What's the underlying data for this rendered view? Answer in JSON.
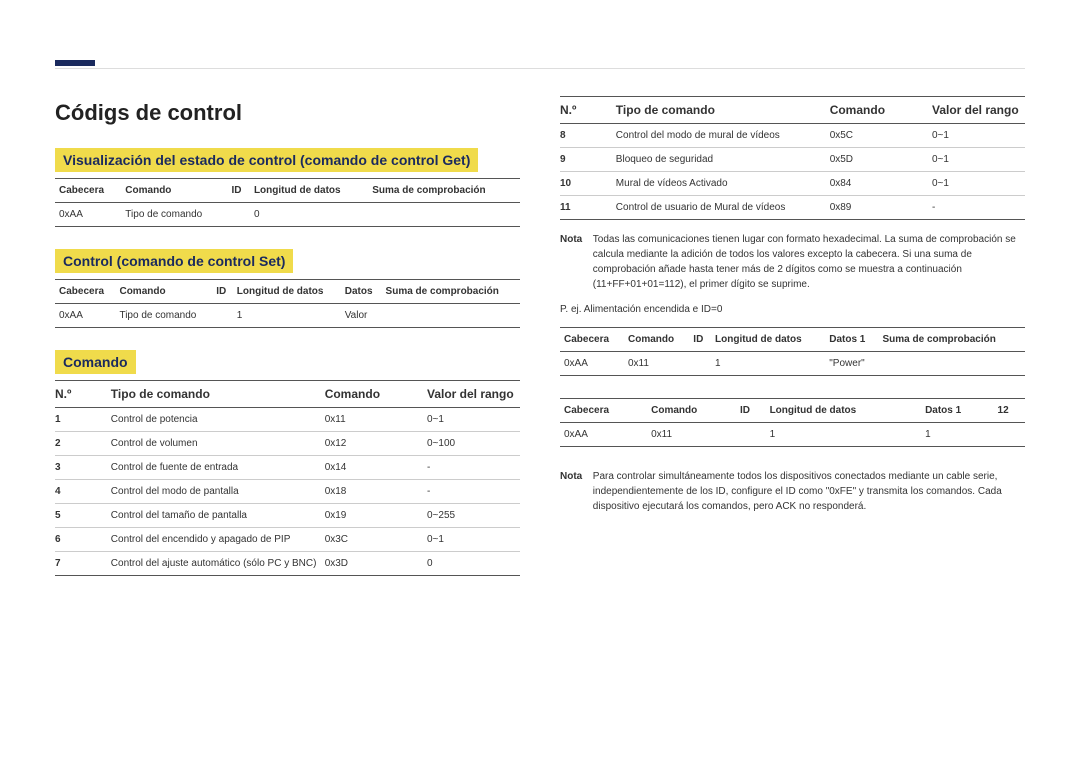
{
  "page_title": "Códigs de control",
  "section1": {
    "title": "Visualización del estado de control (comando de control Get)",
    "headers": [
      "Cabecera",
      "Comando",
      "ID",
      "Longitud de datos",
      "Suma de comprobación"
    ],
    "row": [
      "0xAA",
      "Tipo de comando",
      "",
      "0",
      ""
    ]
  },
  "section2": {
    "title": "Control (comando de control Set)",
    "headers": [
      "Cabecera",
      "Comando",
      "ID",
      "Longitud de datos",
      "Datos",
      "Suma de comprobación"
    ],
    "row": [
      "0xAA",
      "Tipo de comando",
      "",
      "1",
      "Valor",
      ""
    ]
  },
  "section3": {
    "title": "Comando",
    "cols": [
      "N.º",
      "Tipo de comando",
      "Comando",
      "Valor del rango"
    ],
    "rows_left": [
      [
        "1",
        "Control de potencia",
        "0x11",
        "0~1"
      ],
      [
        "2",
        "Control de volumen",
        "0x12",
        "0~100"
      ],
      [
        "3",
        "Control de fuente de entrada",
        "0x14",
        "-"
      ],
      [
        "4",
        "Control del modo de pantalla",
        "0x18",
        "-"
      ],
      [
        "5",
        "Control del tamaño de pantalla",
        "0x19",
        "0~255"
      ],
      [
        "6",
        "Control del encendido y apagado de PIP",
        "0x3C",
        "0~1"
      ],
      [
        "7",
        "Control del ajuste automático (sólo PC y BNC)",
        "0x3D",
        "0"
      ]
    ],
    "rows_right": [
      [
        "8",
        "Control del modo de mural de vídeos",
        "0x5C",
        "0~1"
      ],
      [
        "9",
        "Bloqueo de seguridad",
        "0x5D",
        "0~1"
      ],
      [
        "10",
        "Mural de vídeos Activado",
        "0x84",
        "0~1"
      ],
      [
        "11",
        "Control de usuario de Mural de vídeos",
        "0x89",
        "-"
      ]
    ]
  },
  "note1_label": "Nota",
  "note1": "Todas las comunicaciones tienen lugar con formato hexadecimal. La suma de comprobación se calcula mediante la adición de todos los valores excepto la cabecera. Si una suma de comprobación añade hasta tener más de 2 dígitos como se muestra a continuación (11+FF+01+01=112), el primer dígito se suprime.",
  "example_label": "P. ej. Alimentación encendida e ID=0",
  "example1": {
    "headers": [
      "Cabecera",
      "Comando",
      "ID",
      "Longitud de datos",
      "Datos 1",
      "Suma de comprobación"
    ],
    "row": [
      "0xAA",
      "0x11",
      "",
      "1",
      "\"Power\"",
      ""
    ]
  },
  "example2": {
    "headers": [
      "Cabecera",
      "Comando",
      "ID",
      "Longitud de datos",
      "Datos 1",
      "12"
    ],
    "row": [
      "0xAA",
      "0x11",
      "",
      "1",
      "1",
      ""
    ]
  },
  "note2_label": "Nota",
  "note2": "Para controlar simultáneamente todos los dispositivos conectados mediante un cable serie, independientemente de los ID, configure el ID como \"0xFE\" y transmita los comandos. Cada dispositivo ejecutará los comandos, pero ACK no responderá."
}
